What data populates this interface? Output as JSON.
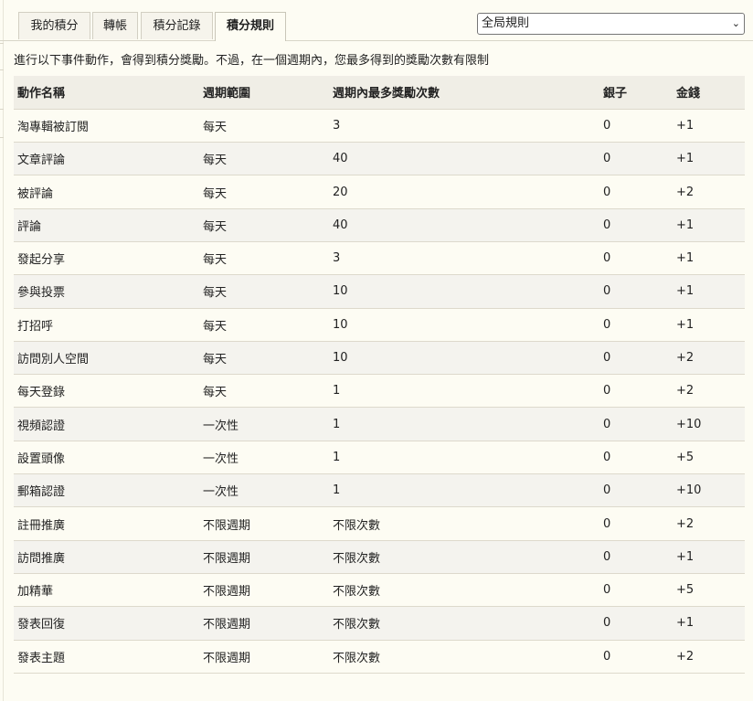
{
  "tabs": [
    {
      "label": "我的積分",
      "active": false
    },
    {
      "label": "轉帳",
      "active": false
    },
    {
      "label": "積分記錄",
      "active": false
    },
    {
      "label": "積分規則",
      "active": true
    }
  ],
  "scope_select": {
    "selected": "全局規則"
  },
  "notice": "進行以下事件動作，會得到積分獎勵。不過，在一個週期內，您最多得到的獎勵次數有限制",
  "table": {
    "headers": [
      "動作名稱",
      "週期範圍",
      "週期內最多獎勵次數",
      "銀子",
      "金錢"
    ],
    "rows": [
      [
        "淘專輯被訂閱",
        "每天",
        "3",
        "0",
        "+1"
      ],
      [
        "文章評論",
        "每天",
        "40",
        "0",
        "+1"
      ],
      [
        "被評論",
        "每天",
        "20",
        "0",
        "+2"
      ],
      [
        "評論",
        "每天",
        "40",
        "0",
        "+1"
      ],
      [
        "發起分享",
        "每天",
        "3",
        "0",
        "+1"
      ],
      [
        "參與投票",
        "每天",
        "10",
        "0",
        "+1"
      ],
      [
        "打招呼",
        "每天",
        "10",
        "0",
        "+1"
      ],
      [
        "訪問別人空間",
        "每天",
        "10",
        "0",
        "+2"
      ],
      [
        "每天登錄",
        "每天",
        "1",
        "0",
        "+2"
      ],
      [
        "視頻認證",
        "一次性",
        "1",
        "0",
        "+10"
      ],
      [
        "設置頭像",
        "一次性",
        "1",
        "0",
        "+5"
      ],
      [
        "郵箱認證",
        "一次性",
        "1",
        "0",
        "+10"
      ],
      [
        "註冊推廣",
        "不限週期",
        "不限次數",
        "0",
        "+2"
      ],
      [
        "訪問推廣",
        "不限週期",
        "不限次數",
        "0",
        "+1"
      ],
      [
        "加精華",
        "不限週期",
        "不限次數",
        "0",
        "+5"
      ],
      [
        "發表回復",
        "不限週期",
        "不限次數",
        "0",
        "+1"
      ],
      [
        "發表主題",
        "不限週期",
        "不限次數",
        "0",
        "+2"
      ]
    ]
  }
}
